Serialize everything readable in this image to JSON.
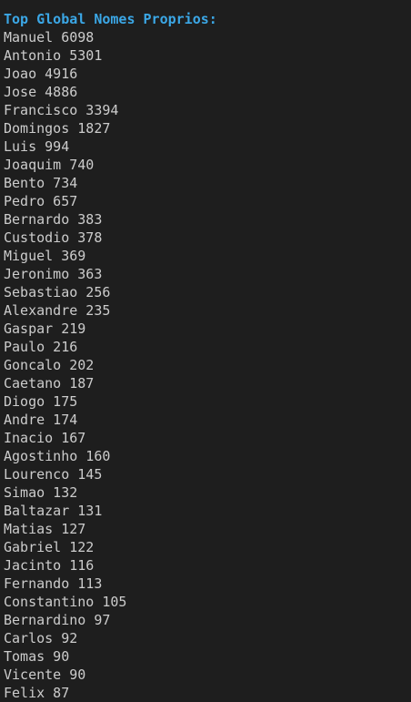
{
  "heading": "Top Global Nomes Proprios:",
  "entries": [
    "Manuel 6098",
    "Antonio 5301",
    "Joao 4916",
    "Jose 4886",
    "Francisco 3394",
    "Domingos 1827",
    "Luis 994",
    "Joaquim 740",
    "Bento 734",
    "Pedro 657",
    "Bernardo 383",
    "Custodio 378",
    "Miguel 369",
    "Jeronimo 363",
    "Sebastiao 256",
    "Alexandre 235",
    "Gaspar 219",
    "Paulo 216",
    "Goncalo 202",
    "Caetano 187",
    "Diogo 175",
    "Andre 174",
    "Inacio 167",
    "Agostinho 160",
    "Lourenco 145",
    "Simao 132",
    "Baltazar 131",
    "Matias 127",
    "Gabriel 122",
    "Jacinto 116",
    "Fernando 113",
    "Constantino 105",
    "Bernardino 97",
    "Carlos 92",
    "Tomas 90",
    "Vicente 90",
    "Felix 87"
  ],
  "colors": {
    "background": "#1e1e1e",
    "heading": "#3ba7e6",
    "text": "#cccccc"
  }
}
